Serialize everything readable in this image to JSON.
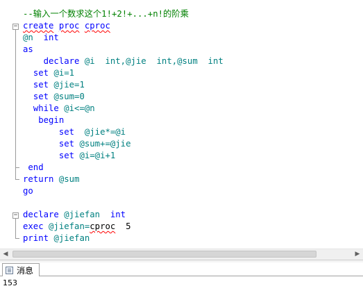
{
  "editor": {
    "comment": "--输入一个数求这个1!+2!+...+n!的阶乘",
    "create": "create",
    "proc": "proc",
    "proc_name": "cproc",
    "param_var": "@n",
    "param_type": "int",
    "as_kw": "as",
    "declare_kw": "declare",
    "declare_vars_1": "@i  int,@jie  int,@sum  int",
    "set_kw": "set",
    "set_i": "@i=1",
    "set_jie": "@jie=1",
    "set_sum": "@sum=0",
    "while_kw": "while",
    "while_cond": "@i<=@n",
    "begin_kw": "begin",
    "set_jie_mul": "@jie*=@i",
    "set_sum_add": "@sum+=@jie",
    "set_i_inc": "@i=@i+1",
    "end_kw": "end",
    "return_kw": "return",
    "return_var": "@sum",
    "go_kw": "go",
    "declare_var_2": "@jiefan",
    "int_kw": "int",
    "exec_kw": "exec",
    "exec_assign": "@jiefan=",
    "exec_proc": "cproc",
    "exec_arg": "5",
    "print_kw": "print",
    "print_var": "@jiefan"
  },
  "results": {
    "tab_label": "消息",
    "message": "153"
  },
  "scrollbar": {
    "left_arrow": "◀",
    "right_arrow": "▶"
  },
  "outline": {
    "minus": "−"
  }
}
